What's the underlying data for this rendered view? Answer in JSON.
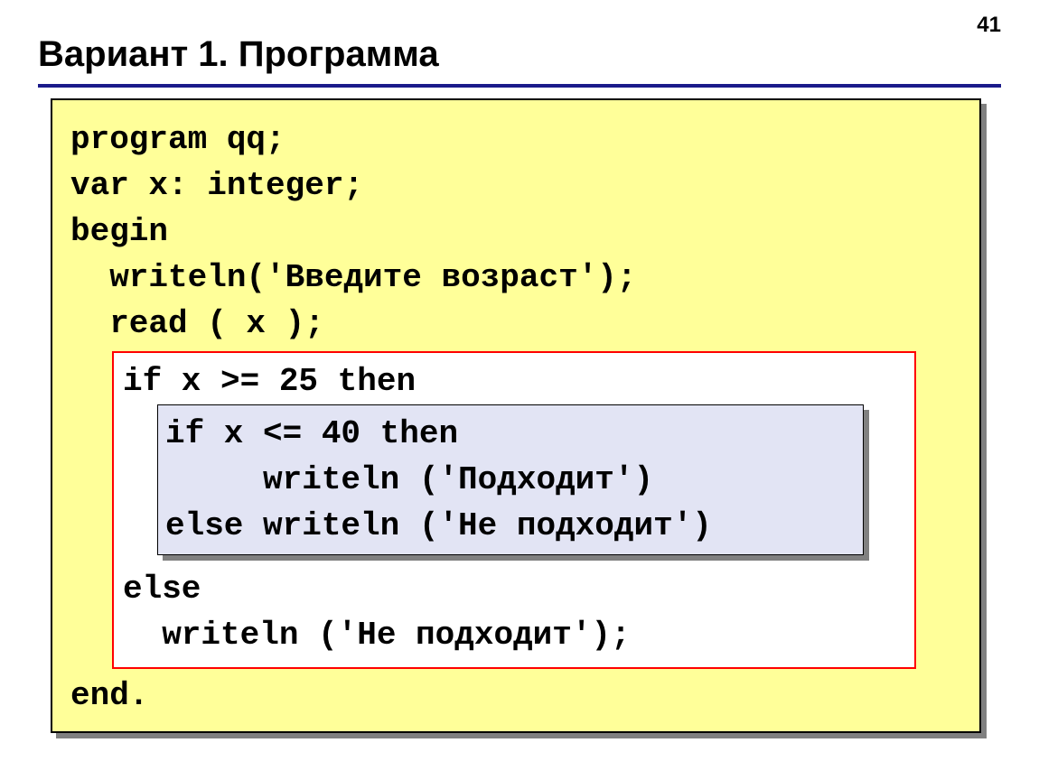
{
  "page_number": "41",
  "title": "Вариант 1. Программа",
  "code": {
    "line1": "program qq;",
    "line2": "var x: integer;",
    "line3": "begin",
    "line4": "  writeln('Введите возраст');",
    "line5": "  read ( x );",
    "red_box": {
      "line1": "if x >= 25 then",
      "inner": {
        "line1": "if x <= 40 then",
        "line2": "     writeln ('Подходит')",
        "line3": "else writeln ('Не подходит')"
      },
      "line2": "else",
      "line3": "  writeln ('Не подходит');"
    },
    "line_end": "end."
  }
}
